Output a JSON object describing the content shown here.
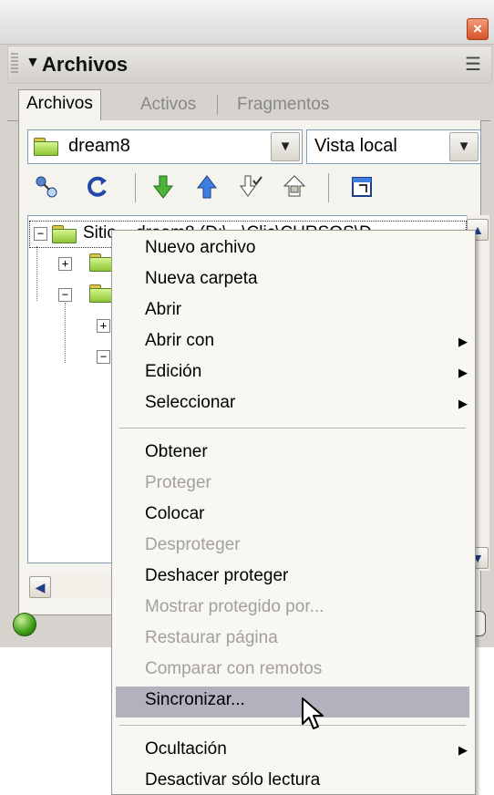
{
  "panel": {
    "title": "Archivos",
    "tabs": [
      {
        "label": "Archivos",
        "active": true
      },
      {
        "label": "Activos",
        "active": false
      },
      {
        "label": "Fragmentos",
        "active": false
      }
    ],
    "site_select": {
      "value": "dream8"
    },
    "view_select": {
      "value": "Vista local"
    },
    "tree": {
      "root_label": "Sitio – dream8 (D:\\...\\Clic\\CURSOS\\D..."
    }
  },
  "toolbar": {
    "icons": [
      "connect-icon",
      "refresh-icon",
      "get-icon",
      "put-icon",
      "check-out-icon",
      "check-in-icon",
      "expand-panel-icon"
    ]
  },
  "context_menu": {
    "items": [
      {
        "label": "Nuevo archivo",
        "enabled": true
      },
      {
        "label": "Nueva carpeta",
        "enabled": true
      },
      {
        "label": "Abrir",
        "enabled": true
      },
      {
        "label": "Abrir con",
        "enabled": true,
        "submenu": true
      },
      {
        "label": "Edición",
        "enabled": true,
        "submenu": true
      },
      {
        "label": "Seleccionar",
        "enabled": true,
        "submenu": true
      },
      {
        "label": "Obtener",
        "enabled": true
      },
      {
        "label": "Proteger",
        "enabled": false
      },
      {
        "label": "Colocar",
        "enabled": true
      },
      {
        "label": "Desproteger",
        "enabled": false
      },
      {
        "label": "Deshacer proteger",
        "enabled": true
      },
      {
        "label": "Mostrar protegido por...",
        "enabled": false
      },
      {
        "label": "Restaurar página",
        "enabled": false
      },
      {
        "label": "Comparar con remotos",
        "enabled": false
      },
      {
        "label": "Sincronizar...",
        "enabled": true,
        "highlighted": true
      },
      {
        "label": "Ocultación",
        "enabled": true,
        "submenu": true
      },
      {
        "label": "Desactivar sólo lectura",
        "enabled": true
      }
    ]
  },
  "colors": {
    "panel_bg": "#d6d3ce",
    "menu_bg": "#f8f7f2",
    "menu_highlight": "#b3b1bd",
    "disabled_text": "#a3a09a",
    "close_button": "#d8532b",
    "status_ok": "#3e9b16"
  }
}
